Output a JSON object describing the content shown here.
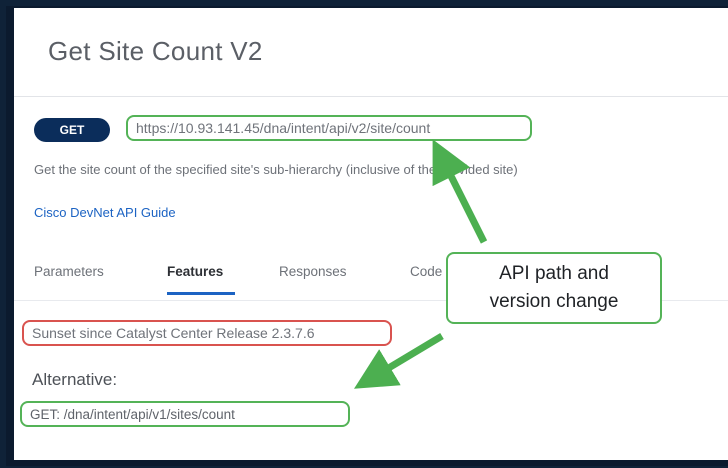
{
  "page": {
    "title": "Get Site Count V2",
    "method": "GET",
    "endpoint_url": "https://10.93.141.45/dna/intent/api/v2/site/count",
    "description": "Get the site count of the specified site's sub-hierarchy (inclusive of the provided site)",
    "guide_link": "Cisco DevNet API Guide"
  },
  "tabs": [
    {
      "label": "Parameters",
      "active": false
    },
    {
      "label": "Features",
      "active": true
    },
    {
      "label": "Responses",
      "active": false
    },
    {
      "label": "Code Preview",
      "active": false
    }
  ],
  "features": {
    "sunset_notice": "Sunset since Catalyst Center Release 2.3.7.6",
    "alternative_heading": "Alternative:",
    "alternative_endpoint": "GET: /dna/intent/api/v1/sites/count"
  },
  "callout": {
    "line1": "API path and",
    "line2": "version change"
  },
  "colors": {
    "highlight_green": "#54b357",
    "highlight_red": "#d9534f",
    "badge_navy": "#0b2d5b",
    "link_blue": "#1c63c3"
  }
}
